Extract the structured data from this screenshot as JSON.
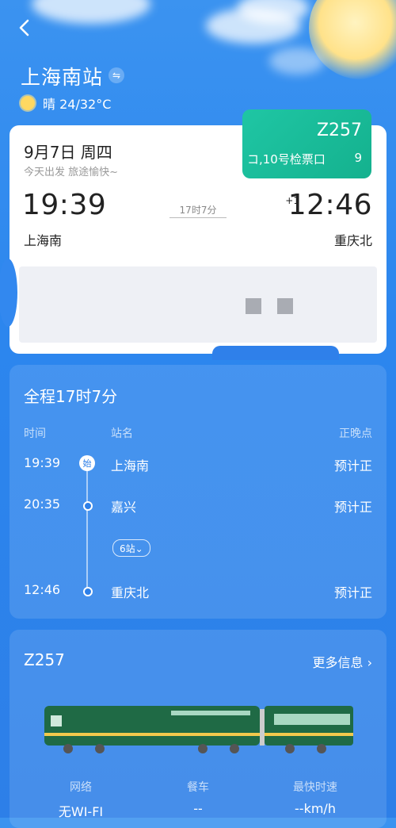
{
  "header": {
    "station": "上海南站",
    "weather_text": "晴 24/32°C"
  },
  "badge": {
    "train": "Z257",
    "gate": "コ,10号检票口",
    "gate_num": "9"
  },
  "ticket": {
    "date": "9月7日  周四",
    "subtitle": "今天出发 旅途愉快~",
    "dep_time": "19:39",
    "arr_time": "12:46",
    "plus_day": "+1",
    "duration": "17时7分",
    "dep_station": "上海南",
    "arr_station": "重庆北"
  },
  "route": {
    "title": "全程17时7分",
    "headers": {
      "time": "时间",
      "station": "站名",
      "status": "正晚点"
    },
    "start_badge": "始",
    "stops_toggle": "6站⌄",
    "rows": [
      {
        "time": "19:39",
        "station": "上海南",
        "status": "预计正"
      },
      {
        "time": "20:35",
        "station": "嘉兴",
        "status": "预计正"
      },
      {
        "time": "12:46",
        "station": "重庆北",
        "status": "预计正"
      }
    ]
  },
  "info": {
    "train": "Z257",
    "more": "更多信息 ›",
    "labels": [
      "网络",
      "餐车",
      "最快时速"
    ],
    "values": [
      "无WI-FI",
      "--",
      "--km/h"
    ]
  },
  "colors": {
    "background": "#2d86ee",
    "badge": "#17b995",
    "train_body": "#1f6a45"
  }
}
